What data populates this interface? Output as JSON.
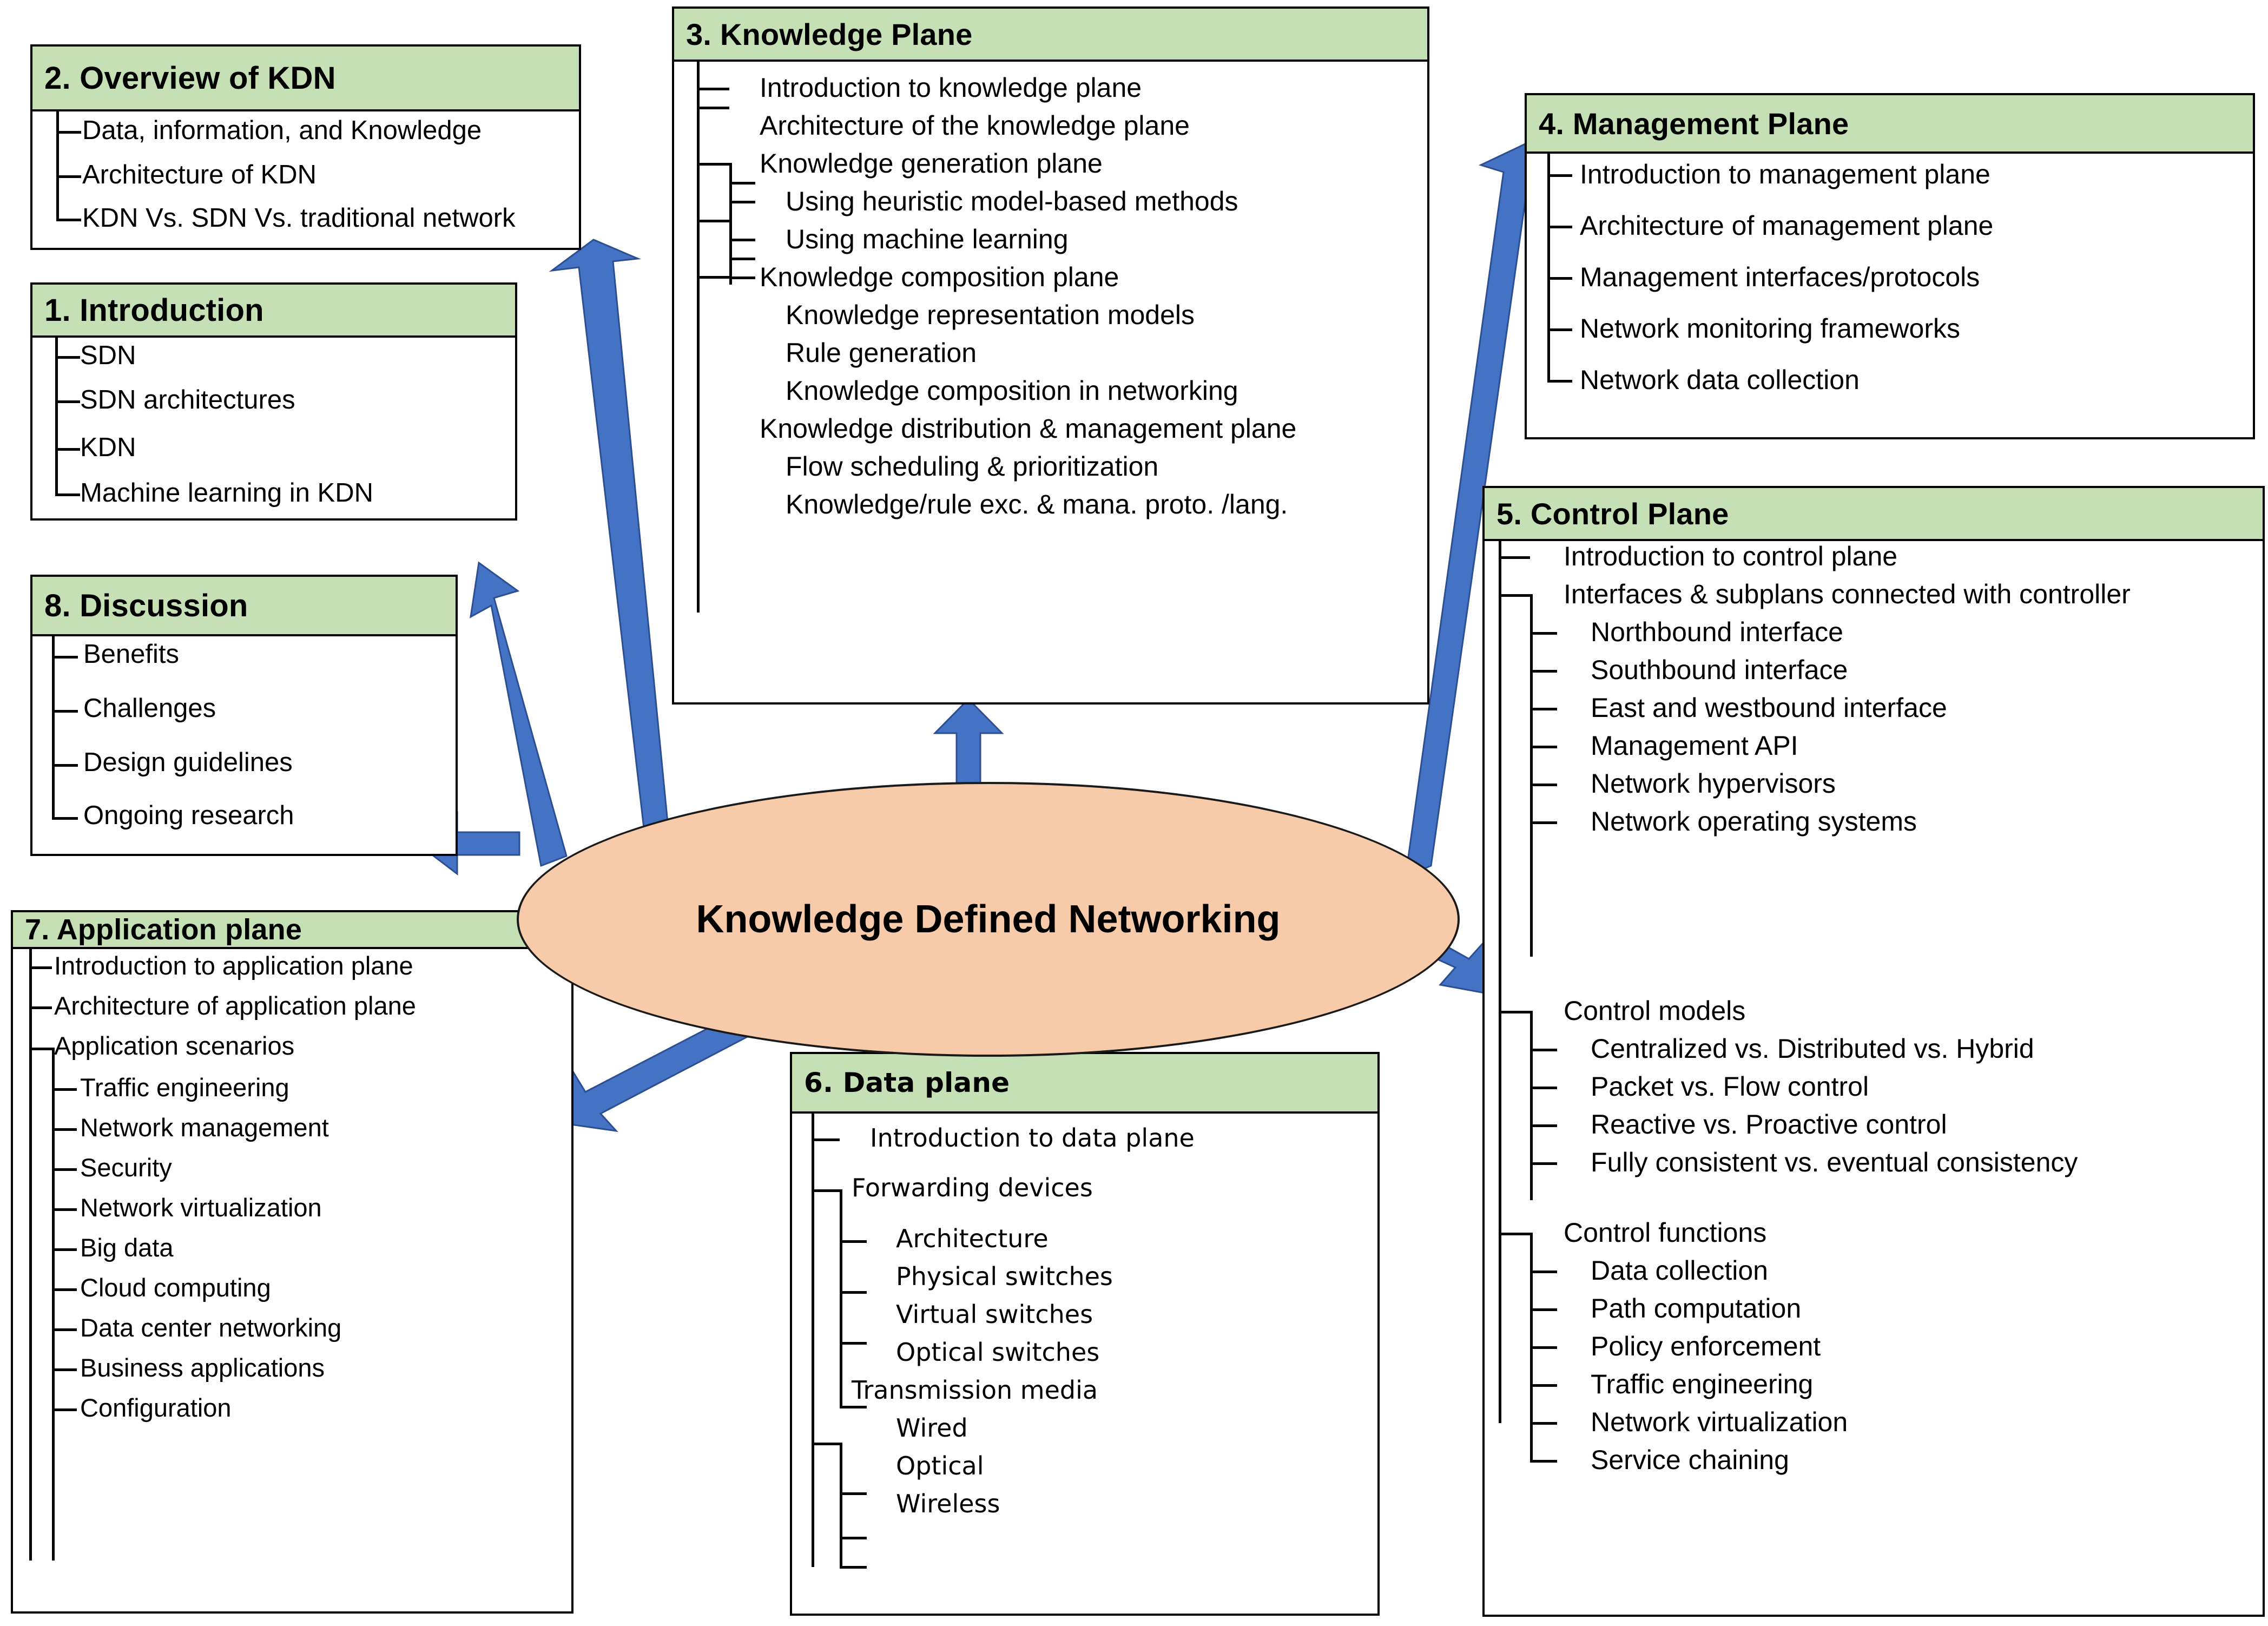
{
  "center": {
    "label": "Knowledge Defined Networking",
    "fill": "#f7cba9",
    "stroke": "#1a1a1a"
  },
  "theme": {
    "header_fill": "#c5e0b4",
    "arrow_fill": "#4472c4",
    "border": "#000000",
    "page_background": "#ffffff"
  },
  "sections": {
    "introduction": {
      "title": "1. Introduction",
      "items": [
        {
          "label": "SDN",
          "level": 1
        },
        {
          "label": "SDN architectures",
          "level": 1
        },
        {
          "label": "KDN",
          "level": 1
        },
        {
          "label": "Machine learning in KDN",
          "level": 1
        }
      ]
    },
    "overview": {
      "title": "2. Overview of KDN",
      "items": [
        {
          "label": "Data, information, and Knowledge",
          "level": 1
        },
        {
          "label": "Architecture of KDN",
          "level": 1
        },
        {
          "label": "KDN Vs. SDN Vs. traditional network",
          "level": 1
        }
      ]
    },
    "knowledge_plane": {
      "title": "3. Knowledge Plane",
      "items": [
        {
          "label": "Introduction to knowledge plane",
          "level": 1
        },
        {
          "label": "Architecture of the knowledge plane",
          "level": 1
        },
        {
          "label": "Knowledge generation plane",
          "level": 1
        },
        {
          "label": "Using heuristic model-based methods",
          "level": 2
        },
        {
          "label": "Using machine learning",
          "level": 2
        },
        {
          "label": "Knowledge composition plane",
          "level": 1
        },
        {
          "label": "Knowledge representation models",
          "level": 2
        },
        {
          "label": "Rule generation",
          "level": 2
        },
        {
          "label": "Knowledge composition in networking",
          "level": 2
        },
        {
          "label": "Knowledge distribution & management plane",
          "level": 1
        },
        {
          "label": "Flow scheduling & prioritization",
          "level": 2
        },
        {
          "label": "Knowledge/rule exc. & mana. proto. /lang.",
          "level": 2
        }
      ]
    },
    "management_plane": {
      "title": "4. Management Plane",
      "items": [
        {
          "label": "Introduction to management plane",
          "level": 1
        },
        {
          "label": "Architecture of management plane",
          "level": 1
        },
        {
          "label": "Management interfaces/protocols",
          "level": 1
        },
        {
          "label": "Network monitoring frameworks",
          "level": 1
        },
        {
          "label": "Network data collection",
          "level": 1
        }
      ]
    },
    "control_plane": {
      "title": "5. Control Plane",
      "items": [
        {
          "label": "Introduction to control plane",
          "level": 1
        },
        {
          "label": "Interfaces & subplans connected with controller",
          "level": 1
        },
        {
          "label": "Northbound interface",
          "level": 2
        },
        {
          "label": "Southbound interface",
          "level": 2
        },
        {
          "label": "East and westbound interface",
          "level": 2
        },
        {
          "label": "Management API",
          "level": 2
        },
        {
          "label": "Network hypervisors",
          "level": 2
        },
        {
          "label": "Network operating systems",
          "level": 2
        },
        {
          "label": "Control models",
          "level": 1
        },
        {
          "label": "Centralized vs. Distributed vs. Hybrid",
          "level": 2
        },
        {
          "label": "Packet vs. Flow control",
          "level": 2
        },
        {
          "label": "Reactive vs. Proactive control",
          "level": 2
        },
        {
          "label": "Fully consistent vs. eventual consistency",
          "level": 2
        },
        {
          "label": "Control functions",
          "level": 1
        },
        {
          "label": "Data collection",
          "level": 2
        },
        {
          "label": "Path computation",
          "level": 2
        },
        {
          "label": "Policy enforcement",
          "level": 2
        },
        {
          "label": "Traffic engineering",
          "level": 2
        },
        {
          "label": "Network virtualization",
          "level": 2
        },
        {
          "label": "Service chaining",
          "level": 2
        }
      ]
    },
    "data_plane": {
      "title": "6. Data plane",
      "items": [
        {
          "label": "Introduction to data plane",
          "level": 1
        },
        {
          "label": "Forwarding devices",
          "level": 1
        },
        {
          "label": "Architecture",
          "level": 2
        },
        {
          "label": "Physical switches",
          "level": 2
        },
        {
          "label": "Virtual switches",
          "level": 2
        },
        {
          "label": "Optical switches",
          "level": 2
        },
        {
          "label": "Transmission media",
          "level": 1
        },
        {
          "label": "Wired",
          "level": 2
        },
        {
          "label": "Optical",
          "level": 2
        },
        {
          "label": "Wireless",
          "level": 2
        }
      ]
    },
    "application_plane": {
      "title": "7. Application plane",
      "items": [
        {
          "label": "Introduction to application plane",
          "level": 1
        },
        {
          "label": "Architecture of application plane",
          "level": 1
        },
        {
          "label": "Application scenarios",
          "level": 1
        },
        {
          "label": "Traffic engineering",
          "level": 2
        },
        {
          "label": "Network management",
          "level": 2
        },
        {
          "label": "Security",
          "level": 2
        },
        {
          "label": "Network virtualization",
          "level": 2
        },
        {
          "label": "Big data",
          "level": 2
        },
        {
          "label": "Cloud computing",
          "level": 2
        },
        {
          "label": "Data center networking",
          "level": 2
        },
        {
          "label": "Business applications",
          "level": 2
        },
        {
          "label": "Configuration",
          "level": 2
        }
      ]
    },
    "discussion": {
      "title": "8. Discussion",
      "items": [
        {
          "label": "Benefits",
          "level": 1
        },
        {
          "label": "Challenges",
          "level": 1
        },
        {
          "label": "Design guidelines",
          "level": 1
        },
        {
          "label": "Ongoing research",
          "level": 1
        }
      ]
    }
  },
  "connections": [
    {
      "from": "center",
      "to": "overview"
    },
    {
      "from": "center",
      "to": "introduction"
    },
    {
      "from": "center",
      "to": "knowledge_plane"
    },
    {
      "from": "center",
      "to": "management_plane"
    },
    {
      "from": "center",
      "to": "control_plane"
    },
    {
      "from": "center",
      "to": "data_plane"
    },
    {
      "from": "center",
      "to": "application_plane"
    },
    {
      "from": "center",
      "to": "discussion"
    }
  ]
}
